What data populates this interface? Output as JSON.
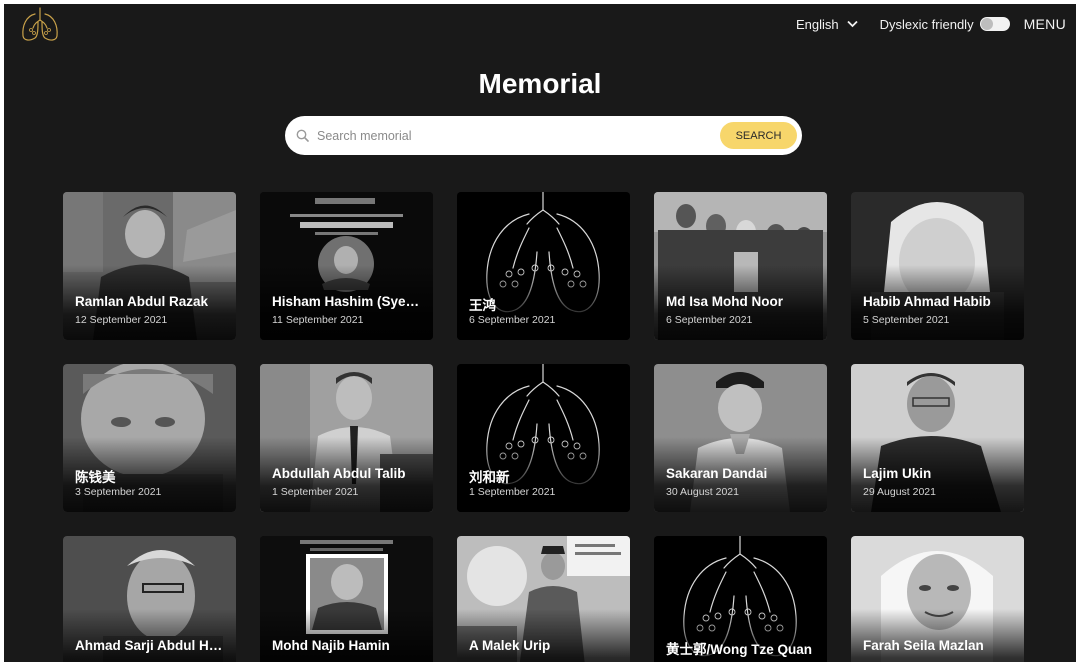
{
  "header": {
    "language": "English",
    "dyslexic_label": "Dyslexic friendly",
    "dyslexic_enabled": false,
    "menu_label": "MENU",
    "accent_color": "#f7d66b",
    "logo_icon": "lungs-logo-icon"
  },
  "page": {
    "title": "Memorial"
  },
  "search": {
    "placeholder": "Search memorial",
    "value": "",
    "button_label": "SEARCH"
  },
  "cards": [
    {
      "name": "Ramlan Abdul Razak",
      "date": "12 September 2021",
      "image": "photo"
    },
    {
      "name": "Hisham Hashim (Syekh)",
      "date": "11 September 2021",
      "image": "photo"
    },
    {
      "name": "王鸿",
      "date": "6 September 2021",
      "image": "lungs-placeholder"
    },
    {
      "name": "Md Isa Mohd Noor",
      "date": "6 September 2021",
      "image": "photo"
    },
    {
      "name": "Habib Ahmad Habib",
      "date": "5 September 2021",
      "image": "photo"
    },
    {
      "name": "陈钱美",
      "date": "3 September 2021",
      "image": "photo"
    },
    {
      "name": "Abdullah Abdul Talib",
      "date": "1 September 2021",
      "image": "photo"
    },
    {
      "name": "刘和新",
      "date": "1 September 2021",
      "image": "lungs-placeholder"
    },
    {
      "name": "Sakaran Dandai",
      "date": "30 August 2021",
      "image": "photo"
    },
    {
      "name": "Lajim Ukin",
      "date": "29 August 2021",
      "image": "photo"
    },
    {
      "name": "Ahmad Sarji Abdul Hamid",
      "date": "",
      "image": "photo"
    },
    {
      "name": "Mohd Najib Hamin",
      "date": "",
      "image": "photo"
    },
    {
      "name": "A Malek Urip",
      "date": "",
      "image": "photo"
    },
    {
      "name": "黄士郭/Wong Tze Quan",
      "date": "",
      "image": "lungs-placeholder"
    },
    {
      "name": "Farah Seila Mazlan",
      "date": "",
      "image": "photo"
    }
  ]
}
